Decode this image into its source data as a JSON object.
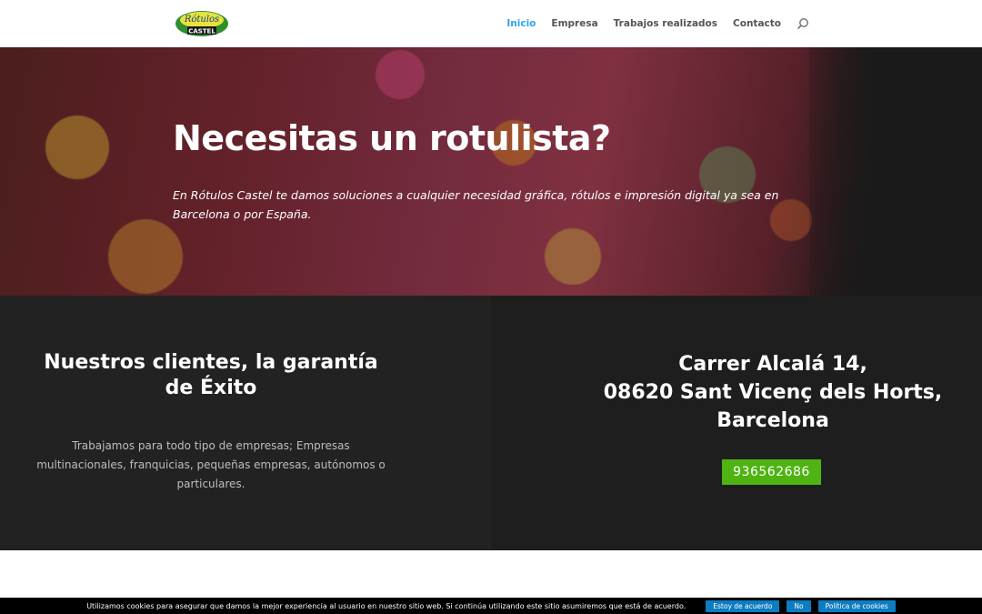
{
  "header": {
    "logo_text_top": "Rótulos",
    "logo_text_bottom": "CASTEL",
    "nav": [
      {
        "label": "Inicio",
        "active": true
      },
      {
        "label": "Empresa",
        "active": false
      },
      {
        "label": "Trabajos realizados",
        "active": false
      },
      {
        "label": "Contacto",
        "active": false
      }
    ],
    "search_icon": "search-icon",
    "accent_color": "#2ea3f2"
  },
  "hero": {
    "title": "Necesitas un rotulista?",
    "text": "En Rótulos Castel te damos soluciones a cualquier necesidad gráfica, rótulos e impresión digital ya sea en Barcelona o por España."
  },
  "info": {
    "left_title": "Nuestros clientes, la garantía de Éxito",
    "left_text": "Trabajamos para todo tipo de empresas; Empresas multinacionales, franquicias, pequeñas empresas, autónomos o particulares.",
    "address_line1": "Carrer Alcalá 14,",
    "address_line2": "08620 Sant Vicenç dels Horts,",
    "address_line3": "Barcelona",
    "phone": "936562686",
    "phone_color": "#4fb312"
  },
  "cookie": {
    "text": "Utilizamos cookies para asegurar que damos la mejor experiencia al usuario en nuestro sitio web. Si continúa utilizando este sitio asumiremos que está de acuerdo.",
    "accept_label": "Estoy de acuerdo",
    "no_label": "No",
    "policy_label": "Política de cookies"
  }
}
